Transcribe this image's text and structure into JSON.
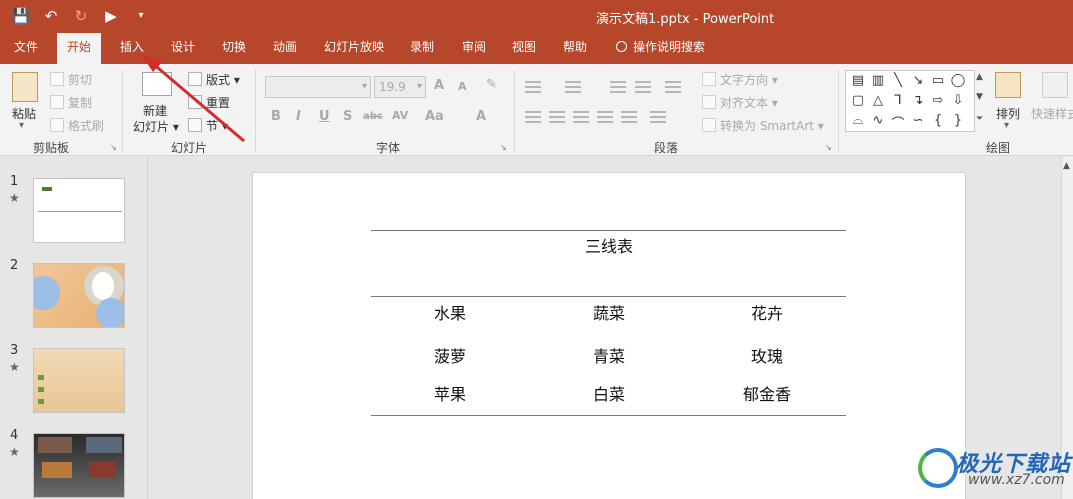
{
  "window": {
    "title": "演示文稿1.pptx  -  PowerPoint"
  },
  "tabs": [
    {
      "label": "文件",
      "active": false
    },
    {
      "label": "开始",
      "active": true
    },
    {
      "label": "插入",
      "active": false
    },
    {
      "label": "设计",
      "active": false
    },
    {
      "label": "切换",
      "active": false
    },
    {
      "label": "动画",
      "active": false
    },
    {
      "label": "幻灯片放映",
      "active": false
    },
    {
      "label": "录制",
      "active": false
    },
    {
      "label": "审阅",
      "active": false
    },
    {
      "label": "视图",
      "active": false
    },
    {
      "label": "帮助",
      "active": false
    }
  ],
  "tell_me": "操作说明搜索",
  "ribbon": {
    "clipboard": {
      "label": "剪贴板",
      "paste": "粘贴",
      "cut": "剪切",
      "copy": "复制",
      "format_painter": "格式刷"
    },
    "slides": {
      "label": "幻灯片",
      "new_slide": "新建",
      "new_slide_2": "幻灯片",
      "layout": "版式",
      "reset": "重置",
      "section": "节"
    },
    "font": {
      "label": "字体",
      "font_name": "",
      "font_size": "19.9",
      "bold": "B",
      "italic": "I",
      "underline": "U",
      "shadow": "S",
      "strike": "abc",
      "spacing": "AV",
      "case": "Aa",
      "color": "A",
      "grow": "A",
      "shrink": "A"
    },
    "paragraph": {
      "label": "段落",
      "text_direction": "文字方向",
      "align_text": "对齐文本",
      "convert_smartart": "转换为 SmartArt"
    },
    "drawing": {
      "label": "绘图",
      "arrange": "排列",
      "quick_styles": "快速样式"
    }
  },
  "slides": [
    {
      "number": "1",
      "star": "★"
    },
    {
      "number": "2",
      "star": ""
    },
    {
      "number": "3",
      "star": "★"
    },
    {
      "number": "4",
      "star": "★"
    }
  ],
  "slide_content": {
    "title": "三线表",
    "header": [
      "水果",
      "蔬菜",
      "花卉"
    ],
    "rows": [
      [
        "菠萝",
        "青菜",
        "玫瑰"
      ],
      [
        "苹果",
        "白菜",
        "郁金香"
      ]
    ]
  },
  "watermark": {
    "title": "极光下载站",
    "url": "www.xz7.com"
  },
  "colors": {
    "brand": "#b7472a",
    "arrow": "#d42b2b"
  }
}
